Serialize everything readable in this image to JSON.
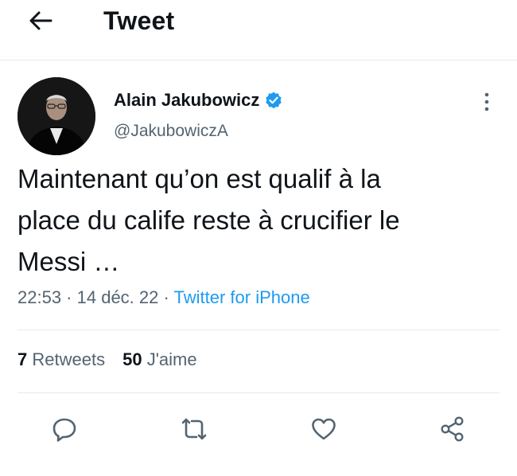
{
  "header": {
    "title": "Tweet",
    "back_icon": "arrow-left-icon"
  },
  "author": {
    "name": "Alain Jakubowicz",
    "handle": "@JakubowiczA",
    "verified": true,
    "verified_color": "#1d9bf0"
  },
  "tweet": {
    "lines": [
      "Maintenant qu’on est qualif à la",
      "place du calife reste à crucifier le",
      "Messi …"
    ],
    "time": "22:53",
    "date": "14 déc. 22",
    "source": "Twitter for iPhone",
    "separator": " · "
  },
  "stats": {
    "retweets_count": "7",
    "retweets_label": "Retweets",
    "likes_count": "50",
    "likes_label": "J'aime"
  },
  "actions": [
    "reply-icon",
    "retweet-icon",
    "like-icon",
    "share-icon"
  ],
  "colors": {
    "accent": "#1d9bf0",
    "text": "#0f1419",
    "secondary": "#536471",
    "divider": "#e7e9ea"
  }
}
